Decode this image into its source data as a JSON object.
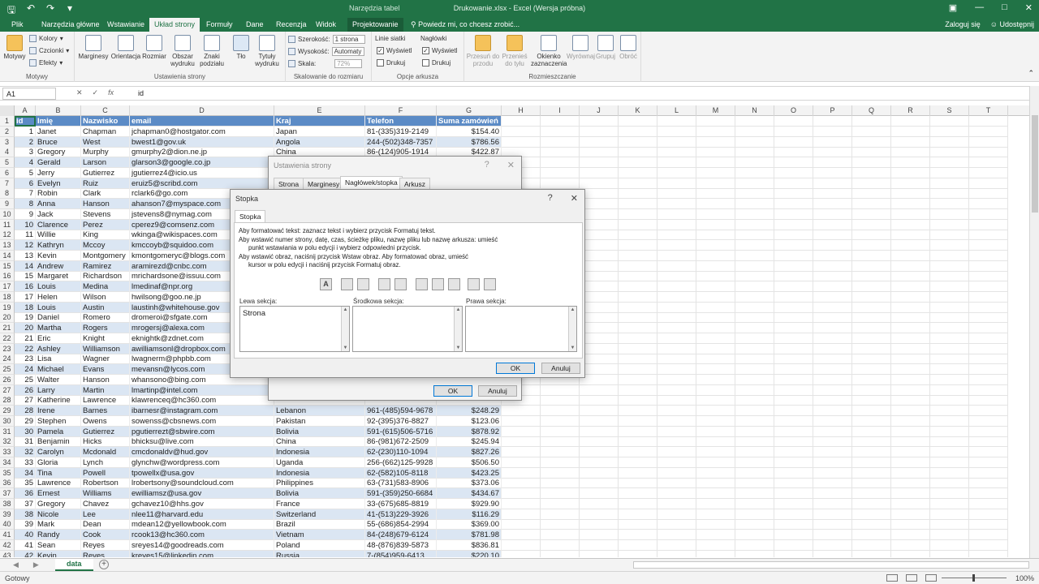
{
  "titlebar": {
    "context_label": "Narzędzia tabel",
    "doc_title": "Drukowanie.xlsx - Excel (Wersja próbna)"
  },
  "tabs": [
    "Plik",
    "Narzędzia główne",
    "Wstawianie",
    "Układ strony",
    "Formuły",
    "Dane",
    "Recenzja",
    "Widok",
    "Projektowanie"
  ],
  "tell_me": "Powiedz mi, co chcesz zrobić...",
  "signin": "Zaloguj się",
  "share": "Udostępnij",
  "ribbon": {
    "themes": {
      "main": "Motywy",
      "colors": "Kolory",
      "fonts": "Czcionki",
      "effects": "Efekty",
      "group": "Motywy"
    },
    "page_setup": {
      "margins": "Marginesy",
      "orientation": "Orientacja",
      "size": "Rozmiar",
      "print_area_1": "Obszar",
      "print_area_2": "wydruku",
      "breaks_1": "Znaki",
      "breaks_2": "podziału",
      "background": "Tło",
      "titles_1": "Tytuły",
      "titles_2": "wydruku",
      "group": "Ustawienia strony"
    },
    "scale": {
      "width_label": "Szerokość:",
      "width_value": "1 strona",
      "height_label": "Wysokość:",
      "height_value": "Automaty",
      "scale_label": "Skala:",
      "scale_value": "72%",
      "group": "Skalowanie do rozmiaru"
    },
    "sheet_opts": {
      "gridlines": "Linie siatki",
      "headings": "Nagłówki",
      "view1": "Wyświetl",
      "view2": "Wyświetl",
      "print1": "Drukuj",
      "print2": "Drukuj",
      "group": "Opcje arkusza"
    },
    "arrange": {
      "forward_1": "Przesuń do",
      "forward_2": "przodu",
      "back_1": "Przenieś",
      "back_2": "do tyłu",
      "pane_1": "Okienko",
      "pane_2": "zaznaczenia",
      "align": "Wyrównaj",
      "group_btn": "Grupuj",
      "rotate": "Obróć",
      "group": "Rozmieszczanie"
    }
  },
  "formula": {
    "namebox": "A1",
    "value": "id"
  },
  "columns": [
    "A",
    "B",
    "C",
    "D",
    "E",
    "F",
    "G",
    "H",
    "I",
    "J",
    "K",
    "L",
    "M",
    "N",
    "O",
    "P",
    "Q",
    "R",
    "S",
    "T"
  ],
  "table_header": [
    "id",
    "Imię",
    "Nazwisko",
    "email",
    "Kraj",
    "Telefon",
    "Suma zamówień"
  ],
  "table_rows": [
    [
      "1",
      "Janet",
      "Chapman",
      "jchapman0@hostgator.com",
      "Japan",
      "81-(335)319-2149",
      "$154.40"
    ],
    [
      "2",
      "Bruce",
      "West",
      "bwest1@gov.uk",
      "Angola",
      "244-(502)348-7357",
      "$786.56"
    ],
    [
      "3",
      "Gregory",
      "Murphy",
      "gmurphy2@dion.ne.jp",
      "China",
      "86-(124)905-1914",
      "$422.87"
    ],
    [
      "4",
      "Gerald",
      "Larson",
      "glarson3@google.co.jp",
      "",
      "",
      ""
    ],
    [
      "5",
      "Jerry",
      "Gutierrez",
      "jgutierrez4@icio.us",
      "",
      "",
      ""
    ],
    [
      "6",
      "Evelyn",
      "Ruiz",
      "eruiz5@scribd.com",
      "",
      "",
      ""
    ],
    [
      "7",
      "Robin",
      "Clark",
      "rclark6@go.com",
      "",
      "",
      ""
    ],
    [
      "8",
      "Anna",
      "Hanson",
      "ahanson7@myspace.com",
      "",
      "",
      ""
    ],
    [
      "9",
      "Jack",
      "Stevens",
      "jstevens8@nymag.com",
      "",
      "",
      ""
    ],
    [
      "10",
      "Clarence",
      "Perez",
      "cperez9@comsenz.com",
      "",
      "",
      ""
    ],
    [
      "11",
      "Willie",
      "King",
      "wkinga@wikispaces.com",
      "",
      "",
      ""
    ],
    [
      "12",
      "Kathryn",
      "Mccoy",
      "kmccoyb@squidoo.com",
      "",
      "",
      ""
    ],
    [
      "13",
      "Kevin",
      "Montgomery",
      "kmontgomeryc@blogs.com",
      "",
      "",
      ""
    ],
    [
      "14",
      "Andrew",
      "Ramirez",
      "aramirezd@cnbc.com",
      "",
      "",
      ""
    ],
    [
      "15",
      "Margaret",
      "Richardson",
      "mrichardsone@issuu.com",
      "",
      "",
      ""
    ],
    [
      "16",
      "Louis",
      "Medina",
      "lmedinaf@npr.org",
      "",
      "",
      ""
    ],
    [
      "17",
      "Helen",
      "Wilson",
      "hwilsong@goo.ne.jp",
      "",
      "",
      ""
    ],
    [
      "18",
      "Louis",
      "Austin",
      "laustinh@whitehouse.gov",
      "",
      "",
      ""
    ],
    [
      "19",
      "Daniel",
      "Romero",
      "dromeroi@sfgate.com",
      "",
      "",
      ""
    ],
    [
      "20",
      "Martha",
      "Rogers",
      "mrogersj@alexa.com",
      "",
      "",
      ""
    ],
    [
      "21",
      "Eric",
      "Knight",
      "eknightk@zdnet.com",
      "",
      "",
      ""
    ],
    [
      "22",
      "Ashley",
      "Williamson",
      "awilliamsonl@dropbox.com",
      "",
      "",
      ""
    ],
    [
      "23",
      "Lisa",
      "Wagner",
      "lwagnerm@phpbb.com",
      "",
      "",
      ""
    ],
    [
      "24",
      "Michael",
      "Evans",
      "mevansn@lycos.com",
      "",
      "",
      ""
    ],
    [
      "25",
      "Walter",
      "Hanson",
      "whansono@bing.com",
      "",
      "",
      ""
    ],
    [
      "26",
      "Larry",
      "Martin",
      "lmartinp@intel.com",
      "",
      "",
      ""
    ],
    [
      "27",
      "Katherine",
      "Lawrence",
      "klawrenceq@hc360.com",
      "",
      "",
      ""
    ],
    [
      "28",
      "Irene",
      "Barnes",
      "ibarnesr@instagram.com",
      "Lebanon",
      "961-(485)594-9678",
      "$248.29"
    ],
    [
      "29",
      "Stephen",
      "Owens",
      "sowenss@cbsnews.com",
      "Pakistan",
      "92-(395)376-8827",
      "$123.06"
    ],
    [
      "30",
      "Pamela",
      "Gutierrez",
      "pgutierrezt@sbwire.com",
      "Bolivia",
      "591-(615)506-5716",
      "$878.92"
    ],
    [
      "31",
      "Benjamin",
      "Hicks",
      "bhicksu@live.com",
      "China",
      "86-(981)672-2509",
      "$245.94"
    ],
    [
      "32",
      "Carolyn",
      "Mcdonald",
      "cmcdonaldv@hud.gov",
      "Indonesia",
      "62-(230)110-1094",
      "$827.26"
    ],
    [
      "33",
      "Gloria",
      "Lynch",
      "glynchw@wordpress.com",
      "Uganda",
      "256-(662)125-9928",
      "$506.50"
    ],
    [
      "34",
      "Tina",
      "Powell",
      "tpowellx@usa.gov",
      "Indonesia",
      "62-(582)105-8118",
      "$423.25"
    ],
    [
      "35",
      "Lawrence",
      "Robertson",
      "lrobertsony@soundcloud.com",
      "Philippines",
      "63-(731)583-8906",
      "$373.06"
    ],
    [
      "36",
      "Ernest",
      "Williams",
      "ewilliamsz@usa.gov",
      "Bolivia",
      "591-(359)250-6684",
      "$434.67"
    ],
    [
      "37",
      "Gregory",
      "Chavez",
      "gchavez10@hhs.gov",
      "France",
      "33-(675)685-8819",
      "$929.90"
    ],
    [
      "38",
      "Nicole",
      "Lee",
      "nlee11@harvard.edu",
      "Switzerland",
      "41-(513)229-3926",
      "$116.29"
    ],
    [
      "39",
      "Mark",
      "Dean",
      "mdean12@yellowbook.com",
      "Brazil",
      "55-(686)854-2994",
      "$369.00"
    ],
    [
      "40",
      "Randy",
      "Cook",
      "rcook13@hc360.com",
      "Vietnam",
      "84-(248)679-6124",
      "$781.98"
    ],
    [
      "41",
      "Sean",
      "Reyes",
      "sreyes14@goodreads.com",
      "Poland",
      "48-(876)839-5873",
      "$836.81"
    ],
    [
      "42",
      "Kevin",
      "Reyes",
      "kreyes15@linkedin.com",
      "Russia",
      "7-(854)959-6413",
      "$220.10"
    ]
  ],
  "sheet_tab": "data",
  "status": {
    "ready": "Gotowy",
    "zoom": "100%"
  },
  "page_setup_dialog": {
    "title": "Ustawienia strony",
    "tabs": [
      "Strona",
      "Marginesy",
      "Nagłówek/stopka",
      "Arkusz"
    ],
    "ok": "OK",
    "cancel": "Anuluj"
  },
  "footer_dialog": {
    "title": "Stopka",
    "tab": "Stopka",
    "instructions": [
      "Aby formatować tekst: zaznacz tekst i wybierz przycisk Formatuj tekst.",
      "Aby wstawić numer strony, datę, czas, ścieżkę pliku, nazwę pliku lub nazwę arkusza: umieść",
      "punkt wstawiania w polu edycji i wybierz odpowiedni przycisk.",
      "Aby wstawić obraz, naciśnij przycisk Wstaw obraz. Aby formatować obraz, umieść",
      "kursor w polu edycji i naciśnij przycisk Formatuj obraz."
    ],
    "left_label": "Lewa sekcja:",
    "center_label": "Środkowa sekcja:",
    "right_label": "Prawa sekcja:",
    "left_value": "Strona",
    "ok": "OK",
    "cancel": "Anuluj"
  }
}
